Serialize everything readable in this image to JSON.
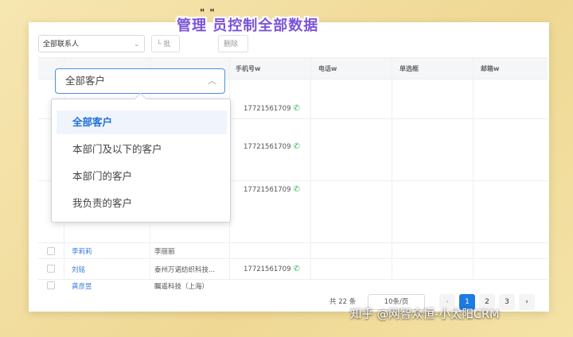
{
  "toolbar": {
    "contact_filter": "全部联系人",
    "btn1_label": "└ 批",
    "btn2_label": "删除"
  },
  "overlay_title": "管理 员控制全部数据",
  "overlay_dots": "\" \"",
  "columns": [
    "手机号w",
    "电话w",
    "单选框",
    "邮箱w"
  ],
  "rows": [
    {
      "phone": "17721561709"
    },
    {
      "phone": "17721561709"
    },
    {
      "phone": "17721561709"
    },
    {
      "name": "李莉莉",
      "company": "李丽丽"
    },
    {
      "name": "刘铭",
      "company": "泰州万诺纺织科技...",
      "phone": "17721561709"
    },
    {
      "name": "龚彦昱",
      "company": "瞩遥科技（上海）"
    }
  ],
  "pagination": {
    "total": "共 22 条",
    "page_size": "10条/页",
    "pages": [
      "1",
      "2",
      "3"
    ],
    "current": "1",
    "prev": "‹",
    "next": "›"
  },
  "dropdown": {
    "value": "全部客户",
    "options": [
      "全部客户",
      "本部门及以下的客户",
      "本部门的客户",
      "我负责的客户"
    ]
  },
  "watermark": "知乎 @网智众恒-小太阳CRM",
  "colors": {
    "accent": "#1e7be0",
    "title": "#7b54d9",
    "phone_icon": "#3bb26a"
  }
}
